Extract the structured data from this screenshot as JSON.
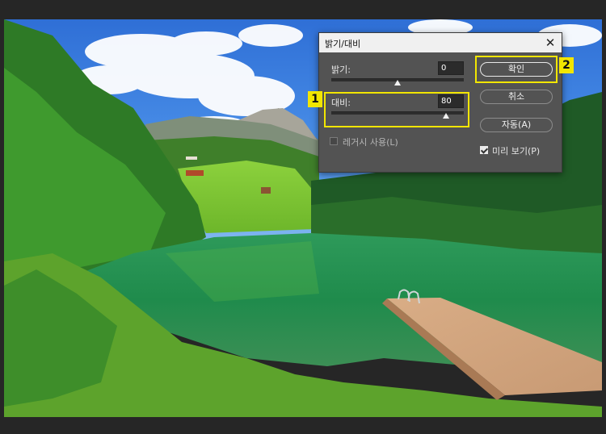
{
  "dialog": {
    "title": "밝기/대비",
    "brightness": {
      "label": "밝기:",
      "value": "0",
      "level": 0
    },
    "contrast": {
      "label": "대비:",
      "value": "80",
      "level": 80
    },
    "legacy": {
      "label": "레거시 사용(L)",
      "checked": false
    },
    "buttons": {
      "ok": "확인",
      "cancel": "취소",
      "auto": "자동(A)"
    },
    "preview": {
      "label": "미리 보기(P)",
      "checked": true
    }
  },
  "annotations": {
    "badge1": "1",
    "badge2": "2",
    "color": "#f2e600"
  },
  "icons": {
    "close": "close-icon"
  }
}
